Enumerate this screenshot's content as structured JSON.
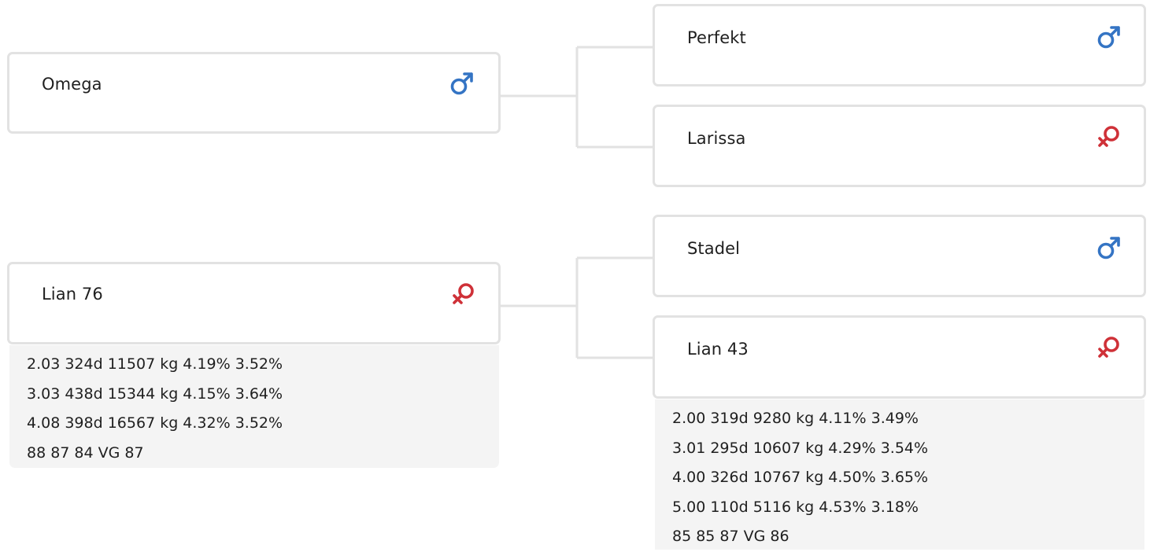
{
  "colors": {
    "male": "#3474c4",
    "female": "#cf3138",
    "border": "#e2e2e2",
    "stats_bg": "#f4f4f4"
  },
  "parents": {
    "sire": {
      "name": "Omega",
      "sex_icon": "male-symbol-icon"
    },
    "dam": {
      "name": "Lian 76",
      "sex_icon": "female-symbol-icon",
      "stats": [
        "2.03 324d 11507 kg 4.19% 3.52%",
        "3.03 438d 15344 kg 4.15% 3.64%",
        "4.08 398d 16567 kg 4.32% 3.52%",
        "88 87 84 VG 87"
      ]
    }
  },
  "grandparents": {
    "sire_sire": {
      "name": "Perfekt",
      "sex_icon": "male-symbol-icon"
    },
    "sire_dam": {
      "name": "Larissa",
      "sex_icon": "female-symbol-icon"
    },
    "dam_sire": {
      "name": "Stadel",
      "sex_icon": "male-symbol-icon"
    },
    "dam_dam": {
      "name": "Lian 43",
      "sex_icon": "female-symbol-icon",
      "stats": [
        "2.00 319d 9280 kg 4.11% 3.49%",
        "3.01 295d 10607 kg 4.29% 3.54%",
        "4.00 326d 10767 kg 4.50% 3.65%",
        "5.00 110d 5116 kg 4.53% 3.18%",
        "85 85 87 VG 86"
      ]
    }
  }
}
